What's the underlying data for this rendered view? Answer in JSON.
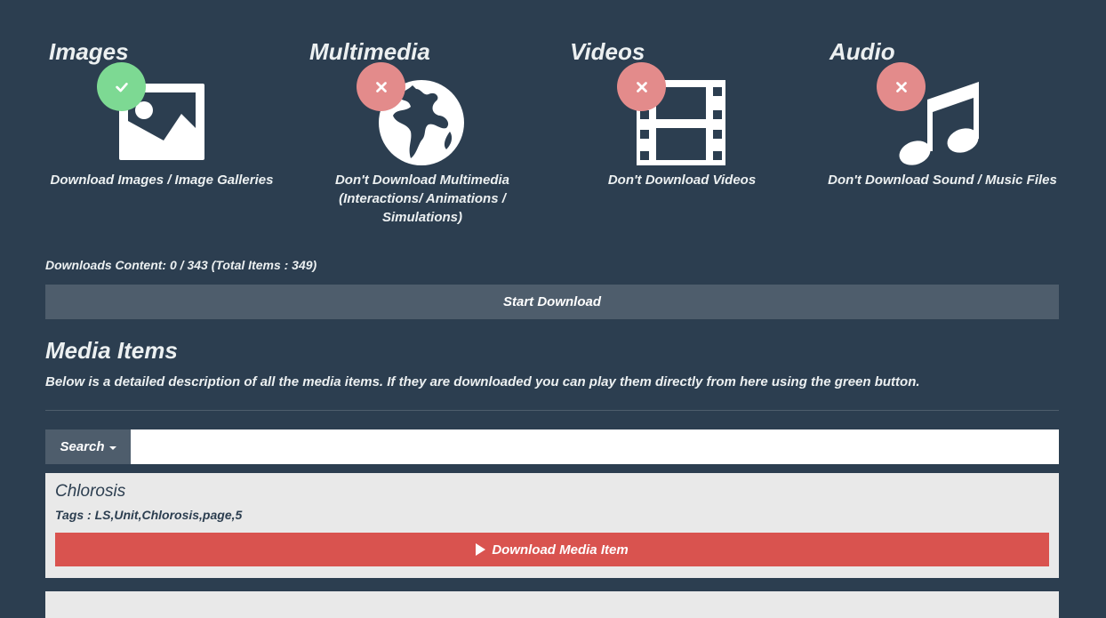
{
  "categories": [
    {
      "title": "Images",
      "description": "Download Images / Image Galleries",
      "status": "enabled",
      "icon": "image-icon",
      "badge_icon": "check-icon"
    },
    {
      "title": "Multimedia",
      "description": "Don't Download Multimedia (Interactions/ Animations / Simulations)",
      "status": "disabled",
      "icon": "globe-icon",
      "badge_icon": "close-icon"
    },
    {
      "title": "Videos",
      "description": "Don't Download Videos",
      "status": "disabled",
      "icon": "film-icon",
      "badge_icon": "close-icon"
    },
    {
      "title": "Audio",
      "description": "Don't Download Sound / Music Files",
      "status": "disabled",
      "icon": "music-icon",
      "badge_icon": "close-icon"
    }
  ],
  "downloads": {
    "counter_text": "Downloads Content: 0 / 343 (Total Items : 349)",
    "start_label": "Start Download"
  },
  "media": {
    "title": "Media Items",
    "description": "Below is a detailed description of all the media items. If they are downloaded you can play them directly from here using the green button.",
    "search_label": "Search",
    "search_value": "",
    "items": [
      {
        "name": "Chlorosis",
        "tags": "Tags : LS,Unit,Chlorosis,page,5",
        "button_label": "Download Media Item"
      }
    ]
  },
  "colors": {
    "background": "#2c3e50",
    "enabled_badge": "#7dd993",
    "disabled_badge": "#e38b8b",
    "download_button": "#d9534f",
    "neutral_button": "#4e5d6c"
  }
}
